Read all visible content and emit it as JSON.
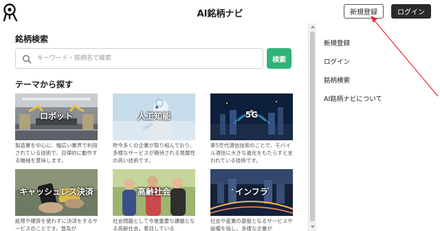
{
  "header": {
    "title": "AI銘柄ナビ",
    "register_label": "新規登録",
    "login_label": "ログイン"
  },
  "search": {
    "section_title": "銘柄検索",
    "placeholder": "キーワード・銘柄名で検索",
    "button_label": "検索"
  },
  "themes": {
    "section_title": "テーマから探す",
    "cards": [
      {
        "label": "ロボット",
        "desc": "製造業を中心に、幅広い業界で利用されている技術で、自律的に動作する機械を意味します。"
      },
      {
        "label": "人工知能",
        "desc": "昨今多くの企業が取り組んでおり、多様なサービスが期待される発展性の高い技術です。"
      },
      {
        "label": "5G",
        "desc": "第5世代通信技術のことで、モバイル通信に大きな進化をもたらすと言われている技術です。"
      },
      {
        "label": "キャッシュレス決済",
        "desc": "紙幣や硬貨を使わずに決済をするサービスのことです。普及が"
      },
      {
        "label": "高齢社会",
        "desc": "社会問題として今後重要な課題となる高齢社会。着目している"
      },
      {
        "label": "インフラ",
        "desc": "社会や産業の基盤となるサービスや設備を指し、多様な企業が"
      }
    ]
  },
  "sidenav": {
    "items": [
      "新規登録",
      "ログイン",
      "銘柄検索",
      "AI銘柄ナビについて"
    ]
  },
  "colors": {
    "search_button": "#2fb37a",
    "login_button": "#2b2b2b",
    "annotation_arrow": "#e8293a"
  }
}
